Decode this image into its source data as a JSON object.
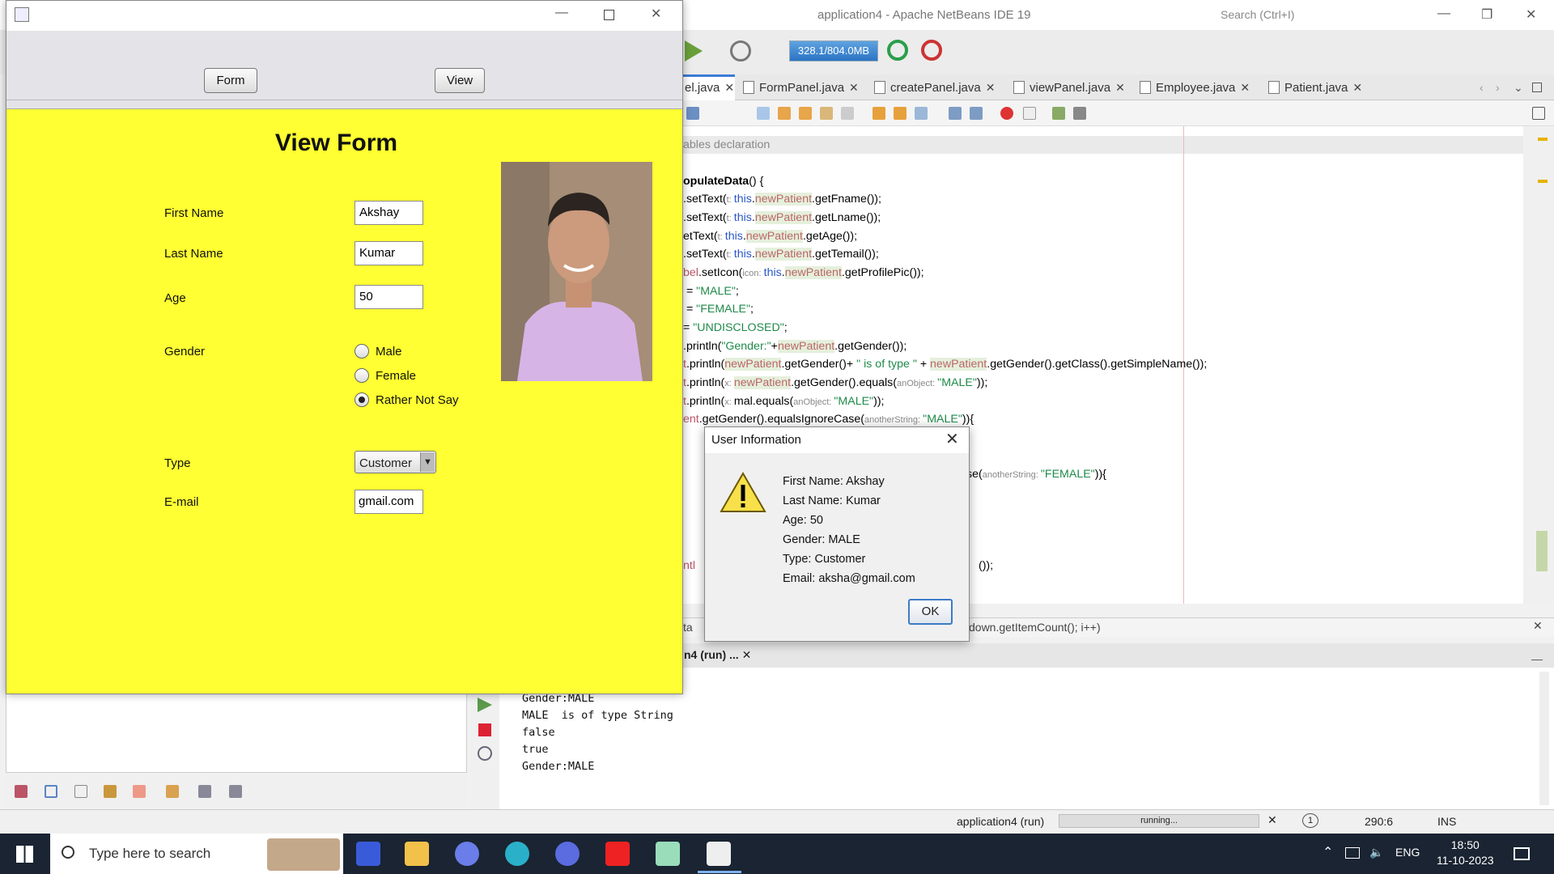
{
  "ide": {
    "title": "application4 - Apache NetBeans IDE 19",
    "search_placeholder": "Search (Ctrl+I)",
    "memory": "328.1/804.0MB",
    "tabs": [
      {
        "label": "el.java"
      },
      {
        "label": "FormPanel.java"
      },
      {
        "label": "createPanel.java"
      },
      {
        "label": "viewPanel.java"
      },
      {
        "label": "Employee.java"
      },
      {
        "label": "Patient.java"
      }
    ],
    "code_lines": [
      "ables declaration",
      "opulateData() {",
      ".setText(t: this.newPatient.getFname());",
      ".setText(t: this.newPatient.getLname());",
      "etText(t: this.newPatient.getAge());",
      ".setText(t: this.newPatient.getTemail());",
      "bel.setIcon(icon: this.newPatient.getProfilePic());",
      " = \"MALE\";",
      " = \"FEMALE\";",
      "= \"UNDISCLOSED\";",
      ".println(\"Gender:\"+newPatient.getGender());",
      "t.println(newPatient.getGender()+ \" is of type \" + newPatient.getGender().getClass().getSimpleName());",
      "t.println(x: newPatient.getGender().equals(anObject: \"MALE\"));",
      "t.println(x: mal.equals(anObject: \"MALE\"));",
      "ent.getGender().equalsIgnoreCase(anotherString: \"MALE\")){",
      "se(anotherString: \"FEMALE\")){",
      "());"
    ],
    "editor_status_left": "ta",
    "editor_status_right": "down.getItemCount(); i++)",
    "output_tab": "n4 (run) ...",
    "output_lines": [
      "Gender:MALE",
      "MALE  is of type String",
      "false",
      "true",
      "Gender:MALE"
    ],
    "status": {
      "project": "application4 (run)",
      "progress_text": "running...",
      "notifications": "1",
      "position": "290:6",
      "mode": "INS"
    }
  },
  "app": {
    "buttons": {
      "form": "Form",
      "view": "View"
    },
    "view_title": "View Form",
    "fields": {
      "first_name_label": "First Name",
      "first_name_value": "Akshay",
      "last_name_label": "Last Name",
      "last_name_value": "Kumar",
      "age_label": "Age",
      "age_value": "50",
      "gender_label": "Gender",
      "gender_options": [
        "Male",
        "Female",
        "Rather Not Say"
      ],
      "gender_selected": "Rather Not Say",
      "type_label": "Type",
      "type_value": "Customer",
      "email_label": "E-mail",
      "email_value": "gmail.com"
    }
  },
  "dialog": {
    "title": "User Information",
    "icon": "warning-icon",
    "lines": [
      "First Name: Akshay",
      "Last Name: Kumar",
      "Age: 50",
      "Gender: MALE",
      "Type: Customer",
      "Email: aksha@gmail.com"
    ],
    "ok_label": "OK"
  },
  "taskbar": {
    "search_placeholder": "Type here to search",
    "language": "ENG",
    "time": "18:50",
    "date": "11-10-2023"
  },
  "colors": {
    "form_background": "#ffff33",
    "accent": "#3b7bd6"
  }
}
